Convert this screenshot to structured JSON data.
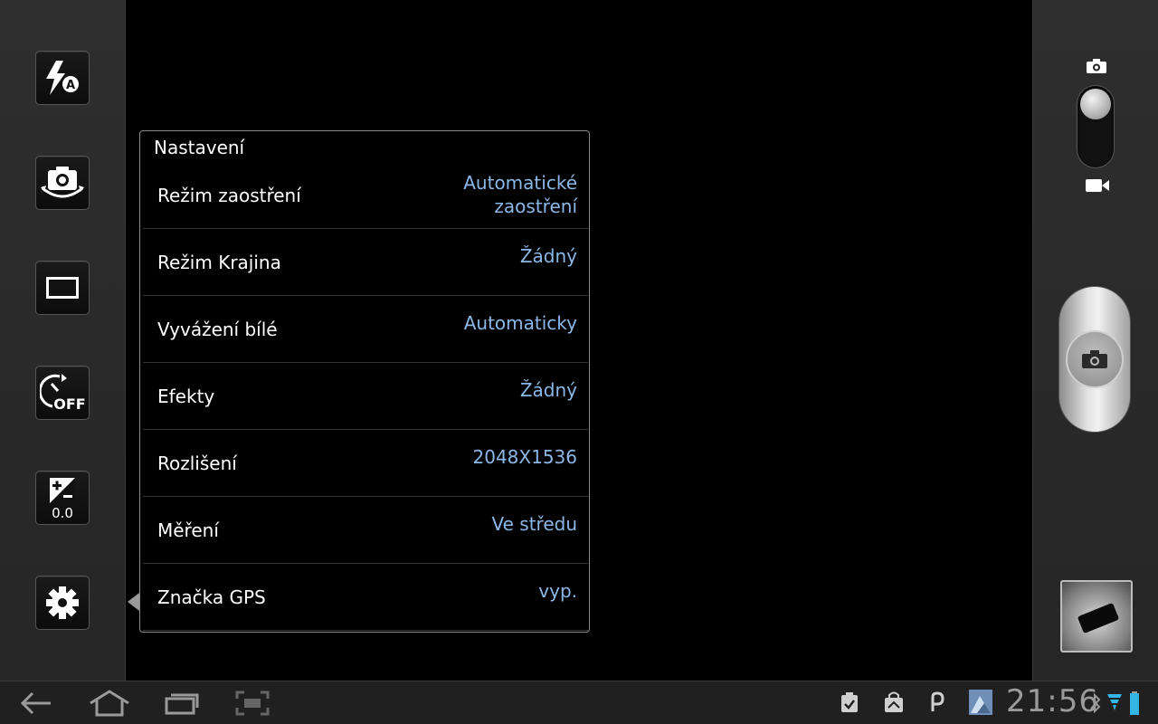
{
  "left_toolbar": {
    "buttons": [
      {
        "name": "flash-auto",
        "icon": "flash-auto-icon"
      },
      {
        "name": "camera-switch",
        "icon": "camera-switch-icon"
      },
      {
        "name": "shooting-mode",
        "icon": "single-shot-icon"
      },
      {
        "name": "timer",
        "icon": "timer-off-icon"
      },
      {
        "name": "exposure",
        "icon": "exposure-icon",
        "value": "0.0"
      },
      {
        "name": "settings",
        "icon": "gear-icon"
      }
    ]
  },
  "settings_panel": {
    "title": "Nastavení",
    "rows": [
      {
        "label": "Režim zaostření",
        "value_line1": "Automatické",
        "value_line2": "zaostření"
      },
      {
        "label": "Režim Krajina",
        "value": "Žádný"
      },
      {
        "label": "Vyvážení bílé",
        "value": "Automaticky"
      },
      {
        "label": "Efekty",
        "value": "Žádný"
      },
      {
        "label": "Rozlišení",
        "value": "2048X1536"
      },
      {
        "label": "Měření",
        "value": "Ve středu"
      },
      {
        "label": "Značka GPS",
        "value": "vyp."
      }
    ]
  },
  "right_bar": {
    "mode_icons": [
      "camera-icon",
      "video-icon"
    ],
    "shutter_icon": "camera-icon"
  },
  "system_bar": {
    "nav": [
      "back-icon",
      "home-icon",
      "recent-apps-icon",
      "screenshot-icon"
    ],
    "status_icons": [
      "clipboard-icon",
      "shopping-bag-icon",
      "p-icon",
      "gallery-icon",
      "bluetooth-icon",
      "wifi-icon",
      "battery-icon"
    ],
    "time": "21:56"
  },
  "colors": {
    "value_text": "#8cb8e8",
    "panel_bg": "#000000",
    "bar_bg": "#2a2a2a"
  }
}
